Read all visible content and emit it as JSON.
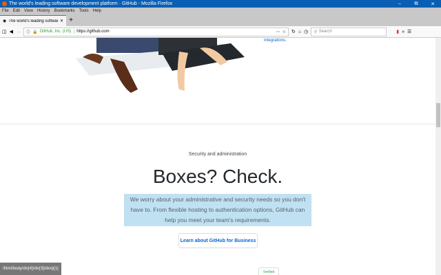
{
  "window": {
    "title": "The world's leading software development platform · GitHub - Mozilla Firefox"
  },
  "menu": [
    "File",
    "Edit",
    "View",
    "History",
    "Bookmarks",
    "Tools",
    "Help"
  ],
  "tab": {
    "title": "The world's leading software d"
  },
  "url": {
    "org": "GitHub, Inc. (US)",
    "address": "https://github.com"
  },
  "search": {
    "placeholder": "Search"
  },
  "page": {
    "integrations_link": "integrations.",
    "eyebrow": "Security and administration",
    "heading": "Boxes? Check.",
    "lead": "We worry about your administrative and security needs so you don't have to. From flexible hosting to authentication options, GitHub can help you meet your team's requirements.",
    "cta": "Learn about GitHub for Business",
    "verified": "Verified"
  },
  "status": "/html/body/div[4]/div[3]/div/p[1]"
}
